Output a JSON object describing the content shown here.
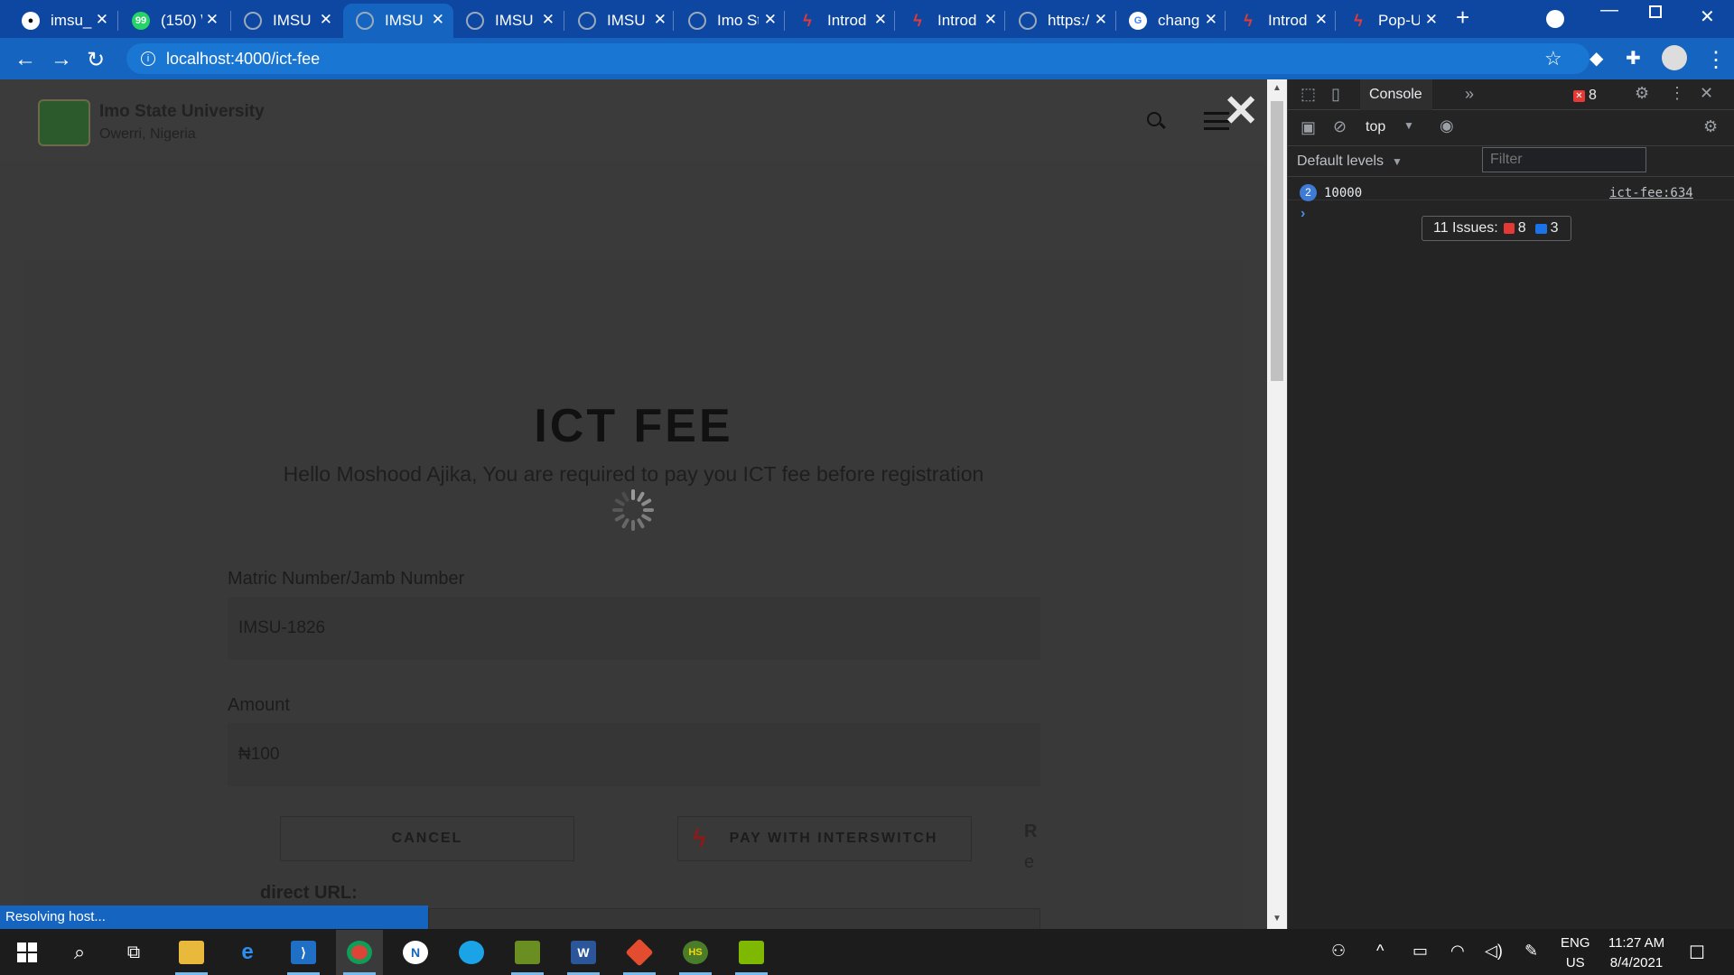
{
  "browser": {
    "tabs": [
      {
        "title": "imsu_",
        "icon": "github-icon"
      },
      {
        "title": "(150) \\",
        "icon": "whatsapp-icon"
      },
      {
        "title": "IMSU",
        "icon": "globe-icon"
      },
      {
        "title": "IMSU",
        "icon": "globe-icon",
        "active": true
      },
      {
        "title": "IMSU",
        "icon": "globe-icon"
      },
      {
        "title": "IMSU",
        "icon": "globe-icon"
      },
      {
        "title": "Imo St",
        "icon": "globe-icon"
      },
      {
        "title": "Introd",
        "icon": "interswitch-icon"
      },
      {
        "title": "Introd",
        "icon": "interswitch-icon"
      },
      {
        "title": "https:/",
        "icon": "globe-icon"
      },
      {
        "title": "chang",
        "icon": "google-icon"
      },
      {
        "title": "Introd",
        "icon": "interswitch-icon"
      },
      {
        "title": "Pop-U",
        "icon": "interswitch-icon"
      }
    ],
    "url": "localhost:4000/ict-fee",
    "status_text": "Resolving host...",
    "accent": "#1565c0"
  },
  "page": {
    "university_name": "Imo State University",
    "university_location": "Owerri, Nigeria",
    "title": "ICT FEE",
    "subtitle": "Hello Moshood Ajika, You are required to pay you ICT fee before registration",
    "matric_label": "Matric Number/Jamb Number",
    "matric_value": "IMSU-1826",
    "amount_label": "Amount",
    "amount_value": "₦100",
    "cancel_label": "CANCEL",
    "pay_label": "PAY WITH INTERSWITCH",
    "fragment_r": "R",
    "fragment_e": "e",
    "redirect_label": "direct URL:"
  },
  "devtools": {
    "console_tab": "Console",
    "error_count": "8",
    "context": "top",
    "filter_placeholder": "Filter",
    "levels": "Default levels",
    "issues_label": "11 Issues:",
    "issues_errors": "8",
    "issues_messages": "3",
    "log_count": "2",
    "log_value": "10000",
    "log_source": "ict-fee:634"
  },
  "taskbar": {
    "lang_top": "ENG",
    "lang_bottom": "US",
    "time": "11:27 AM",
    "date": "8/4/2021"
  }
}
